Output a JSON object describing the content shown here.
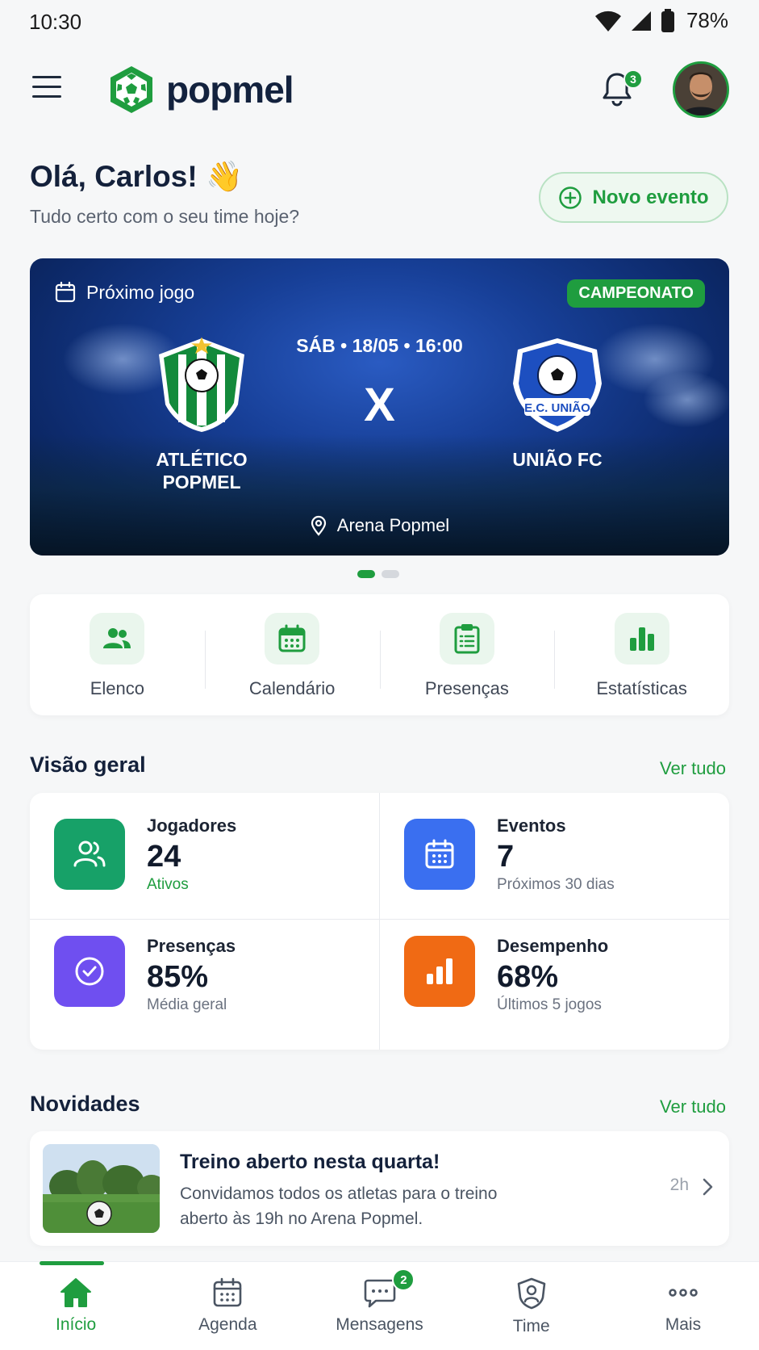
{
  "status_bar": {
    "time": "10:30",
    "battery": "78%"
  },
  "header": {
    "app_name": "popmel",
    "notifications_count": "3"
  },
  "greeting": {
    "title": "Olá, Carlos! 👋",
    "subtitle": "Tudo certo com o seu time hoje?"
  },
  "new_event_button": {
    "label": "Novo evento"
  },
  "next_match": {
    "label": "Próximo jogo",
    "badge": "CAMPEONATO",
    "datetime": "SÁB • 18/05 • 16:00",
    "versus": "X",
    "home_team": {
      "name_line1": "ATLÉTICO",
      "name_line2": "POPMEL"
    },
    "away_team": {
      "name": "UNIÃO FC",
      "crest_text": "E.C. UNIÃO"
    },
    "venue": "Arena Popmel",
    "carousel": {
      "pages": 2,
      "active": 1
    }
  },
  "quick_actions": [
    {
      "label": "Elenco",
      "icon": "team-icon"
    },
    {
      "label": "Calendário",
      "icon": "calendar-icon"
    },
    {
      "label": "Presenças",
      "icon": "clipboard-icon"
    },
    {
      "label": "Estatísticas",
      "icon": "bar-chart-icon"
    }
  ],
  "overview": {
    "title": "Visão geral",
    "link": "Ver tudo",
    "cards": [
      {
        "title": "Jogadores",
        "value": "24",
        "sub": "Ativos",
        "color": "#17a168",
        "icon": "users-icon"
      },
      {
        "title": "Eventos",
        "value": "7",
        "sub": "Próximos 30 dias",
        "color": "#3a6ff0",
        "icon": "calendar-icon"
      },
      {
        "title": "Presenças",
        "value": "85%",
        "sub": "Média geral",
        "color": "#6f4ff0",
        "icon": "check-circle-icon"
      },
      {
        "title": "Desempenho",
        "value": "68%",
        "sub": "Últimos 5 jogos",
        "color": "#f06a14",
        "icon": "bar-chart-icon"
      }
    ]
  },
  "news": {
    "title": "Novidades",
    "link": "Ver tudo",
    "items": [
      {
        "title": "Treino aberto nesta quarta!",
        "body_line1": "Convidamos todos os atletas para o treino",
        "body_line2": "aberto às 19h no Arena Popmel.",
        "time": "2h"
      }
    ]
  },
  "bottom_nav": {
    "items": [
      {
        "label": "Início",
        "icon": "home-icon",
        "active": true
      },
      {
        "label": "Agenda",
        "icon": "calendar-icon"
      },
      {
        "label": "Mensagens",
        "icon": "chat-icon",
        "badge": "2"
      },
      {
        "label": "Time",
        "icon": "shield-user-icon"
      },
      {
        "label": "Mais",
        "icon": "more-icon"
      }
    ]
  },
  "colors": {
    "brand_green": "#1f9d3f",
    "navy": "#14213b"
  }
}
